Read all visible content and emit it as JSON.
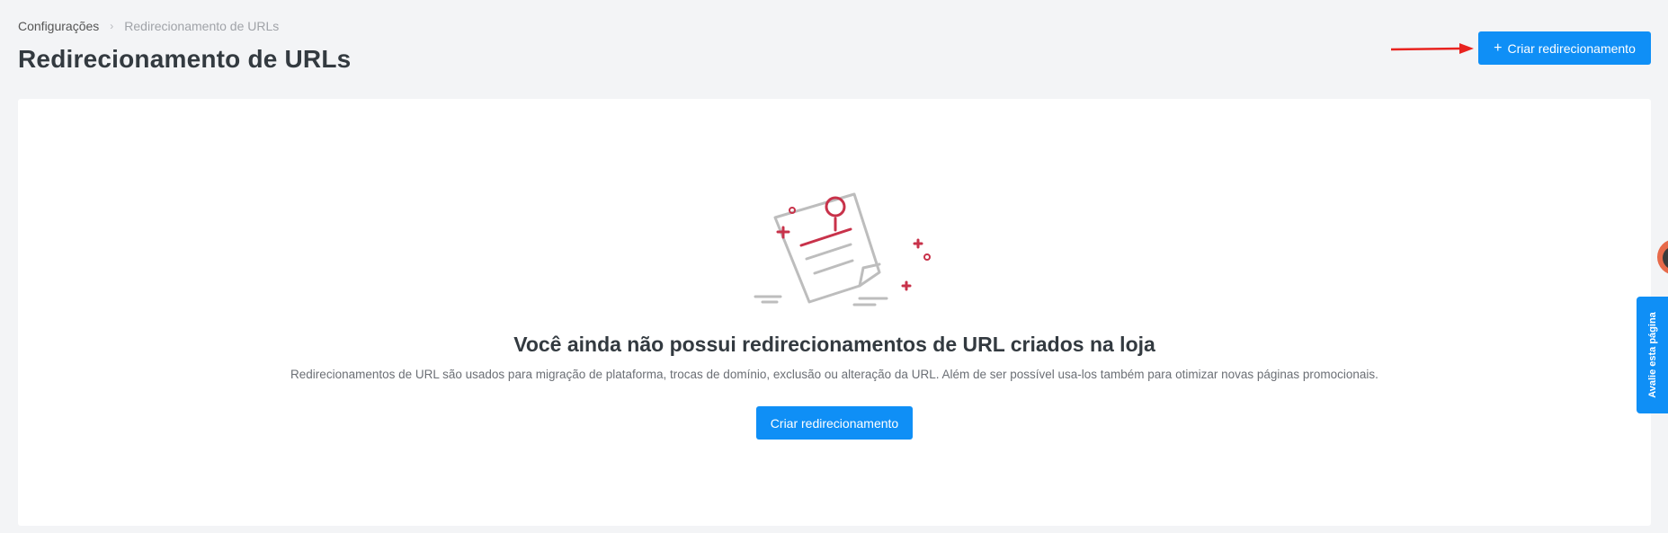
{
  "breadcrumb": {
    "root": "Configurações",
    "separator": "›",
    "current": "Redirecionamento de URLs"
  },
  "page": {
    "title": "Redirecionamento de URLs"
  },
  "header": {
    "create_button_icon": "+",
    "create_button_label": "Criar redirecionamento"
  },
  "empty_state": {
    "illustration_icon": "document-pin-icon",
    "title": "Você ainda não possui redirecionamentos de URL criados na loja",
    "description": "Redirecionamentos de URL são usados para migração de plataforma, trocas de domínio, exclusão ou alteração da URL. Além de ser possível usa-los também para otimizar novas páginas promocionais.",
    "button_label": "Criar redirecionamento"
  },
  "feedback_tab": {
    "label": "Avalie esta página"
  },
  "colors": {
    "primary": "#0f8ff6",
    "accent": "#c8324a",
    "annotation_arrow": "#e8231f",
    "background": "#f3f4f6"
  }
}
